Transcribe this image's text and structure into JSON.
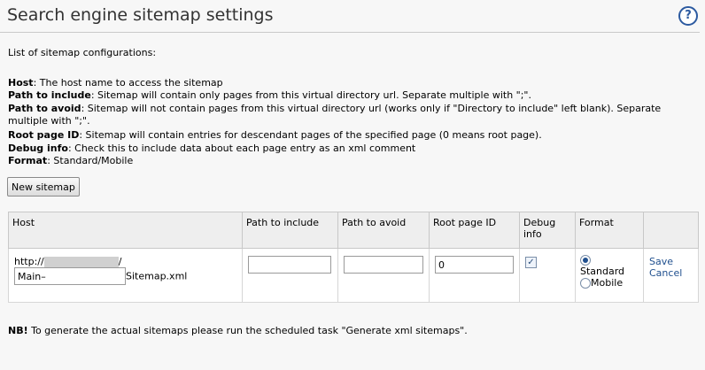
{
  "header": {
    "title": "Search engine sitemap settings",
    "help_label": "?"
  },
  "intro": {
    "list_label": "List of sitemap configurations:",
    "definitions": [
      {
        "term": "Host",
        "text": ": The host name to access the sitemap"
      },
      {
        "term": "Path to include",
        "text": ": Sitemap will contain only pages from this virtual directory url. Separate multiple with \";\"."
      },
      {
        "term": "Path to avoid",
        "text": ": Sitemap will not contain pages from this virtual directory url (works only if \"Directory to include\" left blank). Separate"
      },
      {
        "term": "",
        "text": "multiple with \";\"."
      },
      {
        "term": "Root page ID",
        "text": ": Sitemap will contain entries for descendant pages of the specified page (0 means root page)."
      },
      {
        "term": "Debug info",
        "text": ": Check this to include data about each page entry as an xml comment"
      },
      {
        "term": "Format",
        "text": ": Standard/Mobile"
      }
    ]
  },
  "actions": {
    "new_sitemap": "New sitemap"
  },
  "table": {
    "columns": [
      "Host",
      "Path to include",
      "Path to avoid",
      "Root page ID",
      "Debug info",
      "Format",
      ""
    ],
    "row": {
      "host_prefix": "http://",
      "host_suffix": "/",
      "sitemap_name_value": "Main–",
      "sitemap_suffix": "Sitemap.xml",
      "path_to_include_value": "",
      "path_to_avoid_value": "",
      "root_page_id_value": "0",
      "debug_info_checked": true,
      "format_options": [
        "Standard",
        "Mobile"
      ],
      "format_selected": "Standard",
      "save_label": "Save",
      "cancel_label": "Cancel"
    }
  },
  "footer": {
    "nb_label": "NB!",
    "note": " To generate the actual sitemaps please run the scheduled task \"Generate xml sitemaps\"."
  },
  "colors": {
    "link": "#1f4f8e",
    "header_bg": "#eeeeee",
    "page_bg": "#f7f7f7"
  }
}
